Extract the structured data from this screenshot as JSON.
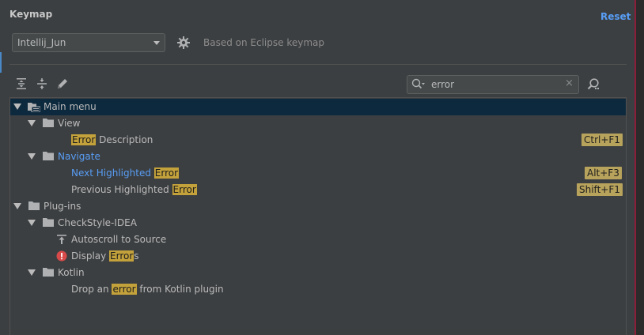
{
  "header": {
    "title": "Keymap",
    "reset_label": "Reset"
  },
  "keymap_select": {
    "selected": "Intellij_Jun"
  },
  "based_on": "Based on Eclipse keymap",
  "search": {
    "value": "error",
    "clear_glyph": "×"
  },
  "colors": {
    "accent": "#589df6",
    "highlight": "#c4a23b",
    "shortcut_bg": "#b8a35c",
    "selection": "#0d293e",
    "error_icon": "#d84a4a"
  },
  "toolbar": {
    "icons": [
      "expand-all-icon",
      "collapse-all-icon",
      "edit-icon"
    ]
  },
  "tree": {
    "main_menu": "Main menu",
    "view": "View",
    "error_desc": {
      "hl": "Error",
      "rest": " Description",
      "shortcut": "Ctrl+F1"
    },
    "navigate": "Navigate",
    "next_highlighted": {
      "pre": "Next Highlighted ",
      "hl": "Error",
      "shortcut": "Alt+F3"
    },
    "prev_highlighted": {
      "pre": "Previous Highlighted ",
      "hl": "Error",
      "shortcut": "Shift+F1"
    },
    "plugins": "Plug-ins",
    "checkstyle": "CheckStyle-IDEA",
    "autoscroll": "Autoscroll to Source",
    "display_errors": {
      "pre": "Display ",
      "hl": "Error",
      "post": "s"
    },
    "kotlin": "Kotlin",
    "drop_error": {
      "pre": "Drop an ",
      "hl": "error",
      "post": " from Kotlin plugin"
    }
  }
}
